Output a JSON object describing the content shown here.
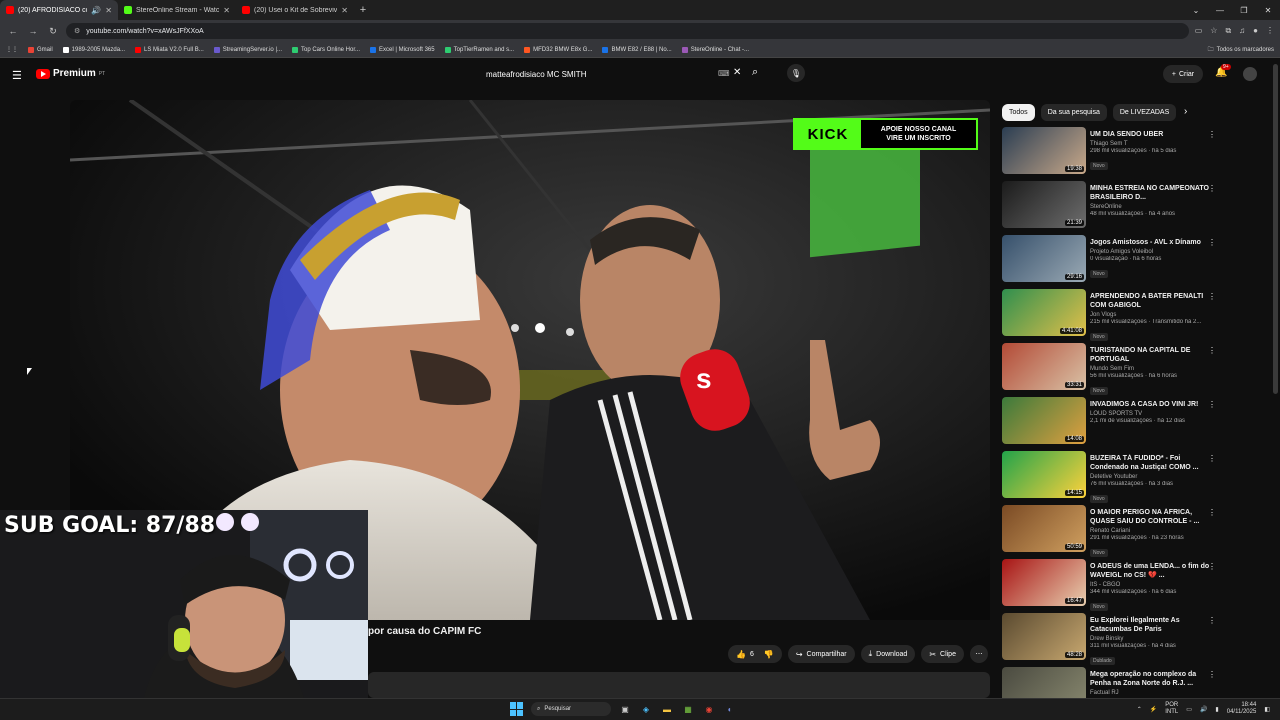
{
  "browser": {
    "tabs": [
      {
        "title": "(20) AFRODISIACO confron",
        "color": "#ff0000",
        "active": true
      },
      {
        "title": "StereOnline Stream - Watch Li",
        "color": "#53fc18",
        "active": false
      },
      {
        "title": "(20) Usei o Kit de Sobrevivência",
        "color": "#ff0000",
        "active": false
      }
    ],
    "url": "youtube.com/watch?v=xAWsJFfXXoA",
    "bookmarks": [
      {
        "label": "Gmail",
        "color": "#ea4335"
      },
      {
        "label": "1989-2005 Mazda...",
        "color": "#ffffff"
      },
      {
        "label": "LS Miata V2.0 Full B...",
        "color": "#ff0000"
      },
      {
        "label": "StreamingServer.io |...",
        "color": "#6a5acd"
      },
      {
        "label": "Top Cars Online Hor...",
        "color": "#2ecc71"
      },
      {
        "label": "Excel | Microsoft 365",
        "color": "#1a73e8"
      },
      {
        "label": "TopTierRamen and s...",
        "color": "#2ecc71"
      },
      {
        "label": "MFD32 BMW E8x G...",
        "color": "#ff5722"
      },
      {
        "label": "BMW E82 / E88 | No...",
        "color": "#1a73e8"
      },
      {
        "label": "StereOnline - Chat -...",
        "color": "#9b59b6"
      }
    ],
    "all_bookmarks": "Todos os marcadores"
  },
  "youtube": {
    "logo": "Premium",
    "region": "PT",
    "search_query": "matteafrodisiaco MC SMITH",
    "create_label": "Criar",
    "notif_count": "9+",
    "kick_logo": "KICK",
    "kick_line1": "APOIE NOSSO CANAL",
    "kick_line2": "VIRE UM INSCRITO",
    "video_title": "por causa do CAPIM FC",
    "likes": "6",
    "share": "Compartilhar",
    "download": "Download",
    "clip": "Clipe",
    "sub_goal": "SUB GOAL: 87/88"
  },
  "chips": [
    "Todos",
    "Da sua pesquisa",
    "De LIVEZADAS"
  ],
  "recommendations": [
    {
      "title": "UM DIA SENDO UBER",
      "channel": "Thiago Sem T",
      "stats": "298 mil visualizações · há 5 dias",
      "badge": "Novo",
      "duration": "19:38",
      "c1": "#2a3d52",
      "c2": "#c9a98a"
    },
    {
      "title": "MINHA ESTREIA NO CAMPEONATO BRASILEIRO D...",
      "channel": "StereOnline",
      "stats": "48 mil visualizações · há 4 anos",
      "badge": "",
      "duration": "21:39",
      "c1": "#1b1b1b",
      "c2": "#6d6d6d"
    },
    {
      "title": "Jogos Amistosos - AVL x Dínamo",
      "channel": "Projeto Amigos Voleibol",
      "stats": "0 visualização · há 6 horas",
      "badge": "Novo",
      "duration": "29:16",
      "c1": "#36506b",
      "c2": "#9aa9b4"
    },
    {
      "title": "APRENDENDO A BATER PENALTI COM GABIGOL",
      "channel": "Jon Vlogs",
      "stats": "215 mil visualizações · Transmitido há 2...",
      "badge": "Novo",
      "duration": "4:41:08",
      "c1": "#2f8f4e",
      "c2": "#e3c04a"
    },
    {
      "title": "TURISTANDO NA CAPITAL DE PORTUGAL",
      "channel": "Mundo Sem Fim",
      "stats": "56 mil visualizações · há 6 horas",
      "badge": "Novo",
      "duration": "33:31",
      "c1": "#b34a36",
      "c2": "#d9c2a6"
    },
    {
      "title": "INVADIMOS A CASA DO VINI JR!",
      "channel": "LOUD SPORTS TV",
      "stats": "2,1 mi de visualizações · há 12 dias",
      "badge": "",
      "duration": "14:08",
      "c1": "#3b7a3b",
      "c2": "#e0a040"
    },
    {
      "title": "BUZEIRA TÁ FUDIDO* - Foi Condenado na Justiça! COMO ...",
      "channel": "Detetive Youtuber",
      "stats": "76 mil visualizações · há 3 dias",
      "badge": "Novo",
      "duration": "14:15",
      "c1": "#22a34a",
      "c2": "#ffd23c"
    },
    {
      "title": "O MAIOR PERIGO NA ÁFRICA, QUASE SAIU DO CONTROLE - ...",
      "channel": "Renato Cariani",
      "stats": "291 mil visualizações · há 23 horas",
      "badge": "Novo",
      "duration": "50:59",
      "c1": "#7a4a24",
      "c2": "#d0a060"
    },
    {
      "title": "O ADEUS de uma LENDA... o fim do WAVEIGL no CS! 💔 ...",
      "channel": "ItS - CBGO",
      "stats": "344 mil visualizações · há 6 dias",
      "badge": "Novo",
      "duration": "16:47",
      "c1": "#a81414",
      "c2": "#e8d0b0"
    },
    {
      "title": "Eu Explorei Ilegalmente As Catacumbas De Paris",
      "channel": "Drew Binsky",
      "stats": "311 mil visualizações · há 4 dias",
      "badge": "Dublado",
      "duration": "48:28",
      "c1": "#5a4a30",
      "c2": "#c8a870"
    },
    {
      "title": "Mega operação no complexo da Penha na Zona Norte do R.J. ...",
      "channel": "Factual RJ",
      "stats": "",
      "badge": "",
      "duration": "",
      "c1": "#4a4a40",
      "c2": "#8a8a70"
    }
  ],
  "taskbar": {
    "search_placeholder": "Pesquisar",
    "lang_line1": "POR",
    "lang_line2": "INTL",
    "time": "18:44",
    "date": "04/11/2025"
  }
}
